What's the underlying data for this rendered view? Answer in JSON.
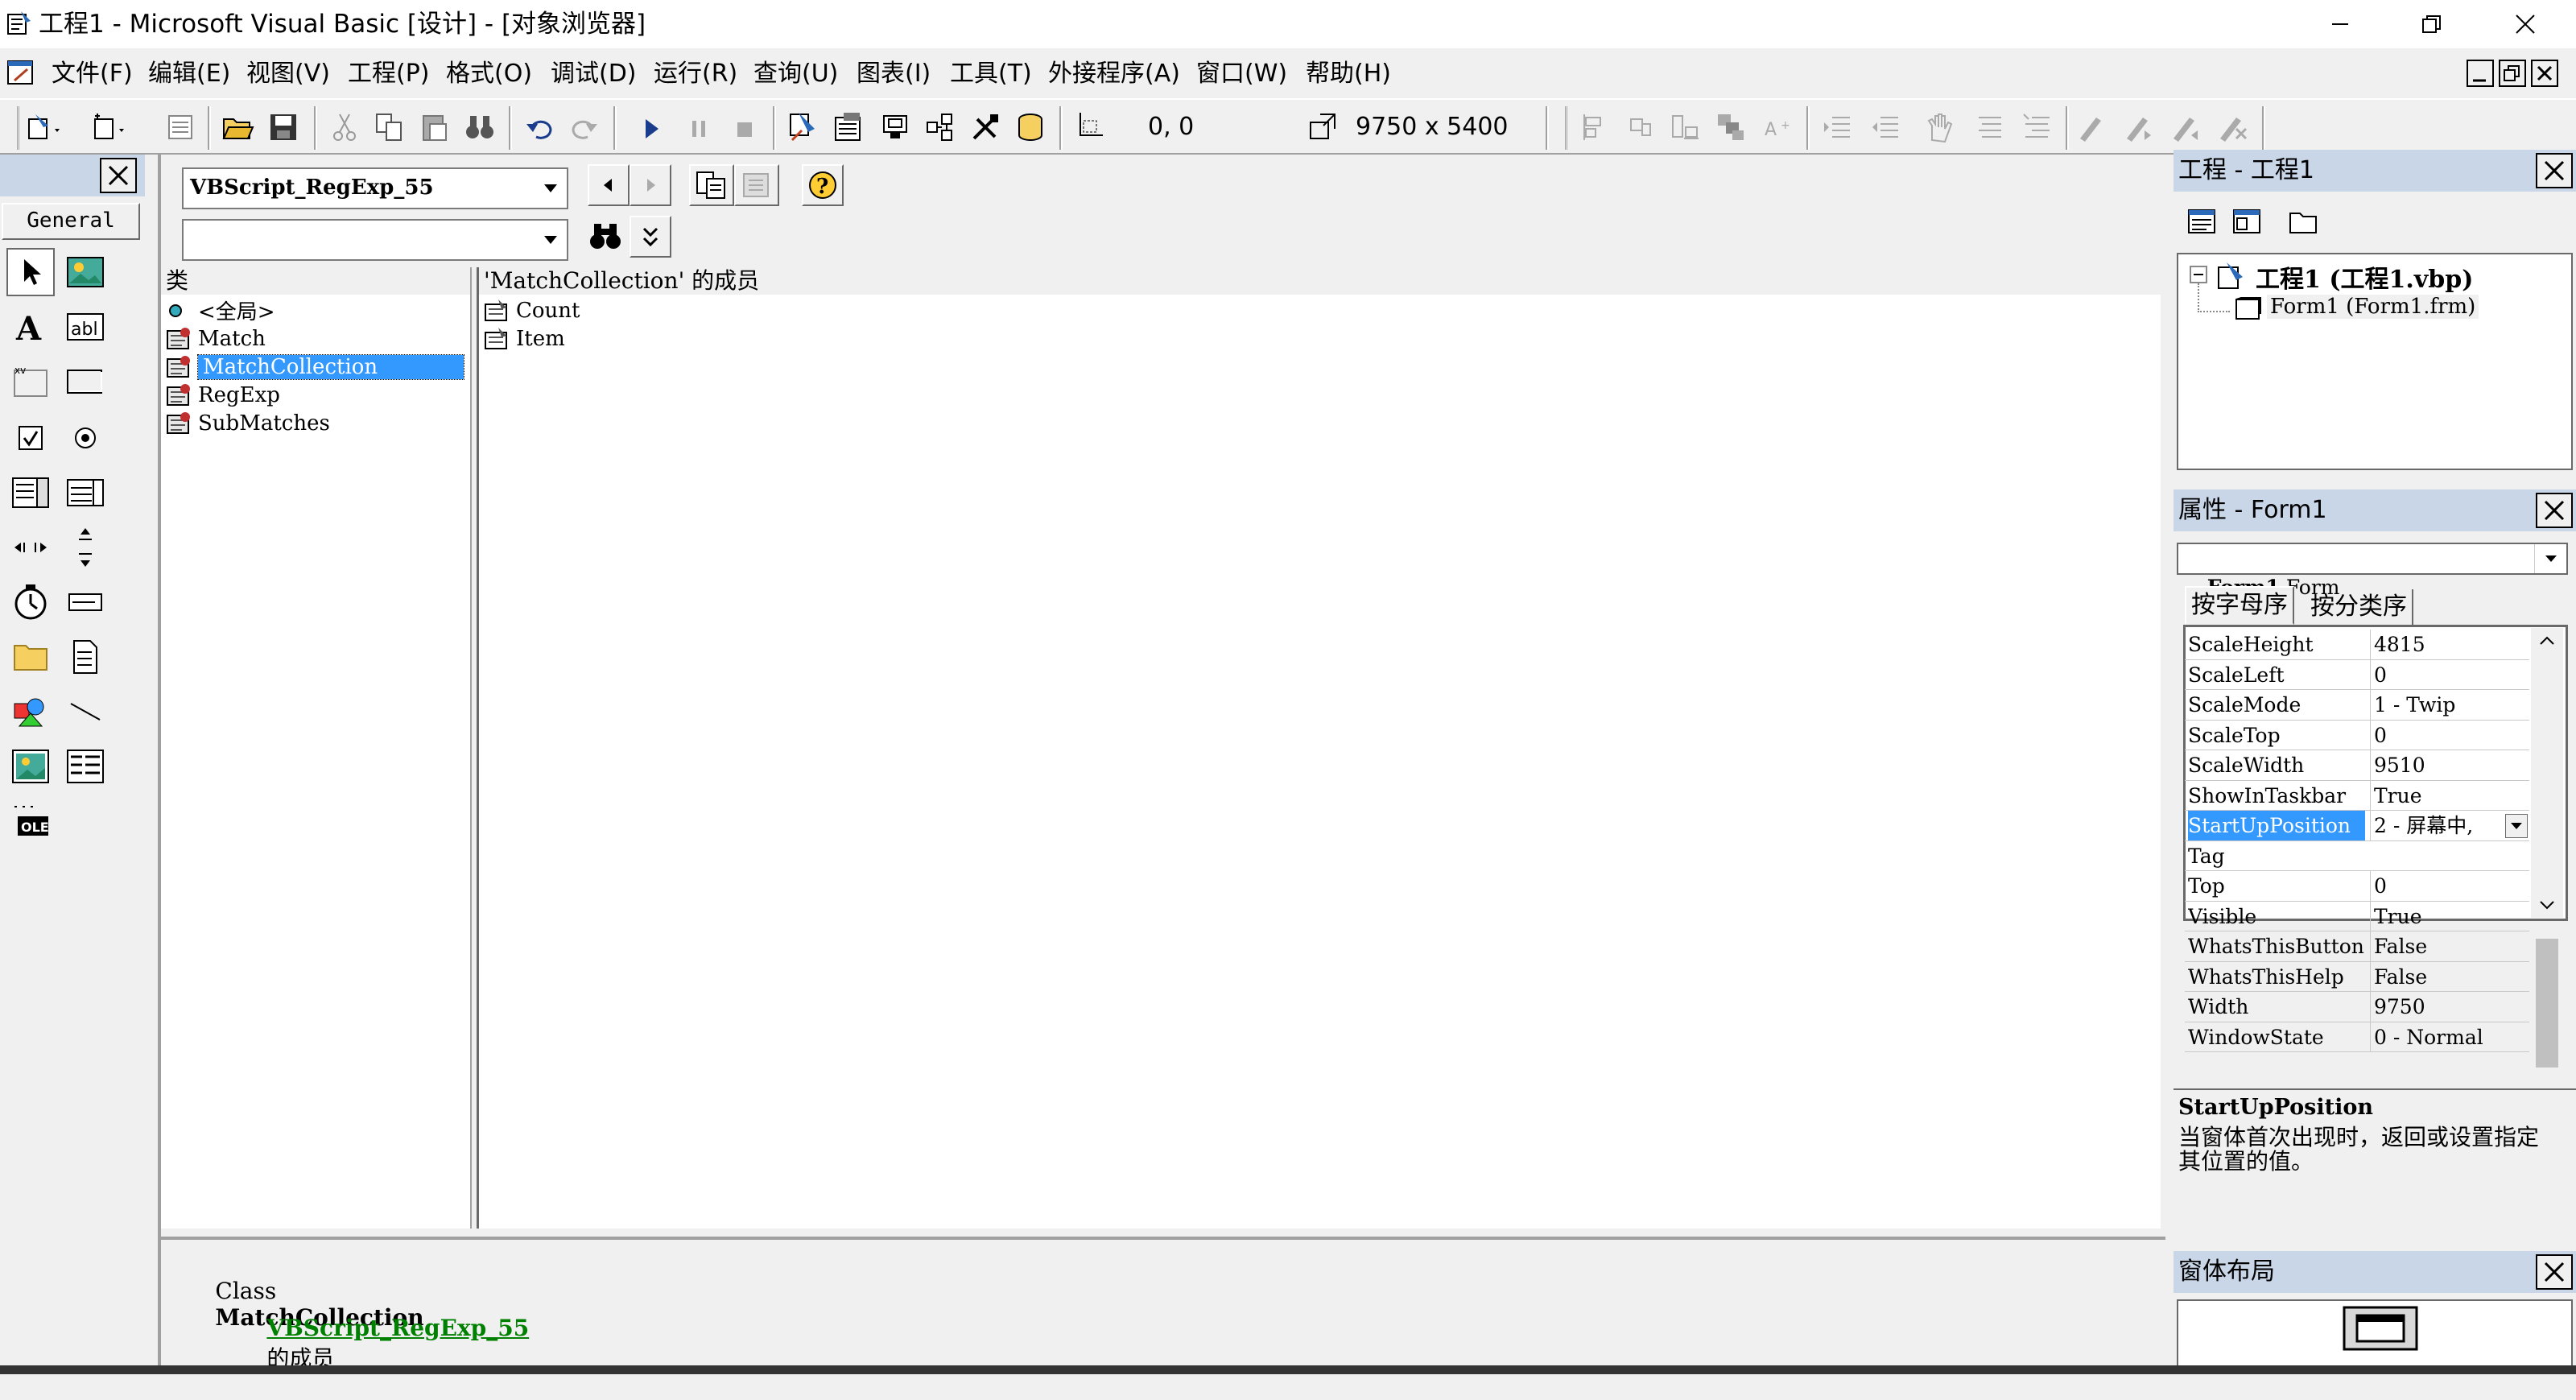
{
  "window": {
    "title": "工程1 - Microsoft Visual Basic [设计] - [对象浏览器]"
  },
  "menu": [
    "文件(F)",
    "编辑(E)",
    "视图(V)",
    "工程(P)",
    "格式(O)",
    "调试(D)",
    "运行(R)",
    "查询(U)",
    "图表(I)",
    "工具(T)",
    "外接程序(A)",
    "窗口(W)",
    "帮助(H)"
  ],
  "toolbar": {
    "position": "0, 0",
    "size": "9750 x 5400"
  },
  "toolbox": {
    "tab_label": "General"
  },
  "browser": {
    "library": "VBScript_RegExp_55",
    "search": "",
    "classes_header": "类",
    "classes": [
      "<全局>",
      "Match",
      "MatchCollection",
      "RegExp",
      "SubMatches"
    ],
    "selected_class_index": 2,
    "members_header": "'MatchCollection' 的成员",
    "members": [
      "Count",
      "Item"
    ],
    "desc_class_word": "Class",
    "desc_class_name": "MatchCollection",
    "desc_link": "VBScript_RegExp_55",
    "desc_suffix": "的成员"
  },
  "project": {
    "panel_title": "工程 - 工程1",
    "root": "工程1 (工程1.vbp)",
    "child": "Form1 (Form1.frm)"
  },
  "properties": {
    "panel_title": "属性 - Form1",
    "object_name": "Form1",
    "object_type": "Form",
    "tabs": [
      "按字母序",
      "按分类序"
    ],
    "rows": [
      {
        "name": "ScaleHeight",
        "value": "4815"
      },
      {
        "name": "ScaleLeft",
        "value": "0"
      },
      {
        "name": "ScaleMode",
        "value": "1 - Twip"
      },
      {
        "name": "ScaleTop",
        "value": "0"
      },
      {
        "name": "ScaleWidth",
        "value": "9510"
      },
      {
        "name": "ShowInTaskbar",
        "value": "True"
      },
      {
        "name": "StartUpPosition",
        "value": "2 - 屏幕中,"
      },
      {
        "name": "Tag",
        "value": ""
      },
      {
        "name": "Top",
        "value": "0"
      },
      {
        "name": "Visible",
        "value": "True"
      },
      {
        "name": "WhatsThisButton",
        "value": "False"
      },
      {
        "name": "WhatsThisHelp",
        "value": "False"
      },
      {
        "name": "Width",
        "value": "9750"
      },
      {
        "name": "WindowState",
        "value": "0 - Normal"
      }
    ],
    "selected_row_index": 6,
    "desc_title": "StartUpPosition",
    "desc_text_line1": "当窗体首次出现时，返回或设置指定",
    "desc_text_line2": "其位置的值。"
  },
  "form_layout": {
    "panel_title": "窗体布局"
  },
  "colors": {
    "selection": "#3399ff",
    "panel_header": "#c9d6e8",
    "link": "#008000"
  }
}
